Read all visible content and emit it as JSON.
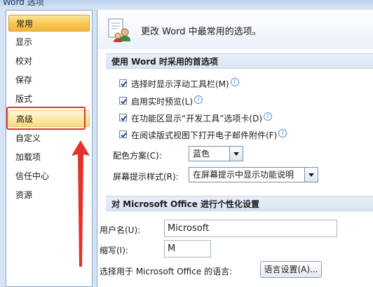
{
  "window": {
    "title": "Word 选项"
  },
  "sidebar": {
    "items": [
      {
        "label": "常用"
      },
      {
        "label": "显示"
      },
      {
        "label": "校对"
      },
      {
        "label": "保存"
      },
      {
        "label": "版式"
      },
      {
        "label": "高级"
      },
      {
        "label": "自定义"
      },
      {
        "label": "加载项"
      },
      {
        "label": "信任中心"
      },
      {
        "label": "资源"
      }
    ]
  },
  "header": {
    "text": "更改 Word 中最常用的选项。"
  },
  "section1": {
    "title": "使用 Word 时采用的首选项",
    "options": [
      {
        "label": "选择时显示浮动工具栏(M)",
        "checked": true,
        "has_info": true
      },
      {
        "label": "启用实时预览(L)",
        "checked": true,
        "has_info": true
      },
      {
        "label": "在功能区显示“开发工具”选项卡(D)",
        "checked": true,
        "has_info": true
      },
      {
        "label": "在阅读版式视图下打开电子邮件附件(F)",
        "checked": true,
        "has_info": true
      }
    ],
    "color_scheme": {
      "label": "配色方案(C):",
      "value": "蓝色"
    },
    "screentip": {
      "label": "屏幕提示样式(R):",
      "value": "在屏幕提示中显示功能说明"
    }
  },
  "section2": {
    "title": "对 Microsoft Office 进行个性化设置",
    "username": {
      "label": "用户名(U):",
      "value": "Microsoft"
    },
    "initials": {
      "label": "缩写(I):",
      "value": "M"
    },
    "language": {
      "label": "选择用于 Microsoft Office 的语言:",
      "button": "语言设置(A)..."
    }
  },
  "colors": {
    "annotation": "#e4322b",
    "selected_item": "#f8c64e"
  }
}
